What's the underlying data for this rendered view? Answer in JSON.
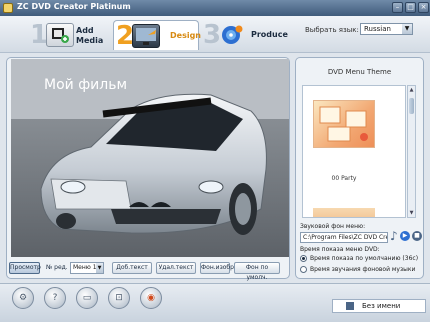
{
  "window": {
    "title": "ZC DVD Creator Platinum"
  },
  "steps": [
    {
      "number": "1",
      "label": "Add\nMedia",
      "label_line1": "Add",
      "label_line2": "Media",
      "icon": "film-add-icon"
    },
    {
      "number": "2",
      "label": "Design",
      "icon": "design-monitor-icon",
      "active": true
    },
    {
      "number": "3",
      "label": "Produce",
      "icon": "disc-burn-icon"
    }
  ],
  "language": {
    "label": "Выбрать язык:",
    "value": "Russian"
  },
  "preview": {
    "title_text": "Мой фильм"
  },
  "controls": {
    "preview_button": "Просмотр",
    "menu_no_label": "№ ред.",
    "menu_select": "Меню 1",
    "add_text": "Доб.текст",
    "delete_text": "Удал.текст",
    "bg_image": "Фон.изобр.",
    "bg_default": "Фон по умолч."
  },
  "theme_panel": {
    "title": "DVD Menu Theme",
    "selected_theme": "00 Party",
    "bg_music_label": "Звуковой фон меню:",
    "bg_music_path": "C:\\Program Files\\ZC DVD Creat",
    "duration_label": "Время показа меню DVD:",
    "option_default": "Время показа по умолчанию (36с)",
    "option_music": "Время звучания фоновой музыки"
  },
  "bottom_toolbar": {
    "buttons": [
      "settings-icon",
      "help-icon",
      "folder-icon",
      "cart-icon",
      "record-icon"
    ],
    "project_name": "Без имени"
  },
  "colors": {
    "accent": "#f0a020",
    "titlebar": "#405b7b"
  }
}
